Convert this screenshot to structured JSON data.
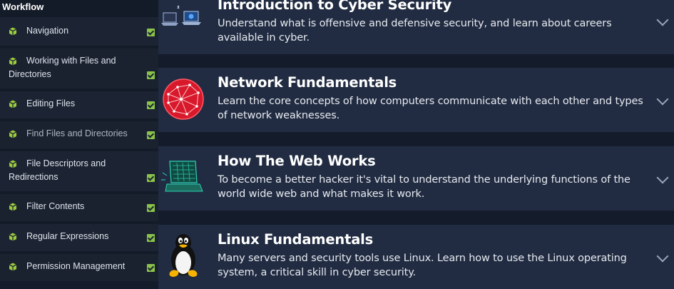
{
  "sidebar": {
    "title": "Workflow",
    "items": [
      {
        "label": "Navigation",
        "completed": true
      },
      {
        "label": "Working with Files and Directories",
        "completed": true
      },
      {
        "label": "Editing Files",
        "completed": true
      },
      {
        "label": "Find Files and Directories",
        "completed": true
      },
      {
        "label": "File Descriptors and Redirections",
        "completed": true
      },
      {
        "label": "Filter Contents",
        "completed": true
      },
      {
        "label": "Regular Expressions",
        "completed": true
      },
      {
        "label": "Permission Management",
        "completed": true
      }
    ]
  },
  "modules": [
    {
      "title": "Introduction to Cyber Security",
      "description": "Understand what is offensive and defensive security, and learn about careers available in cyber.",
      "icon": "laptops-icon"
    },
    {
      "title": "Network Fundamentals",
      "description": "Learn the core concepts of how computers communicate with each other and types of network weaknesses.",
      "icon": "network-globe-icon"
    },
    {
      "title": "How The Web Works",
      "description": "To become a better hacker it's vital to understand the underlying functions of the world wide web and what makes it work.",
      "icon": "web-laptop-icon"
    },
    {
      "title": "Linux Fundamentals",
      "description": "Many servers and security tools use Linux. Learn how to use the Linux operating system, a critical skill in cyber security.",
      "icon": "linux-penguin-icon"
    }
  ],
  "colors": {
    "check": "#8bc34a",
    "cube": "#9ccc3c",
    "card_bg": "#212c42",
    "sidebar_bg": "#141b28"
  }
}
